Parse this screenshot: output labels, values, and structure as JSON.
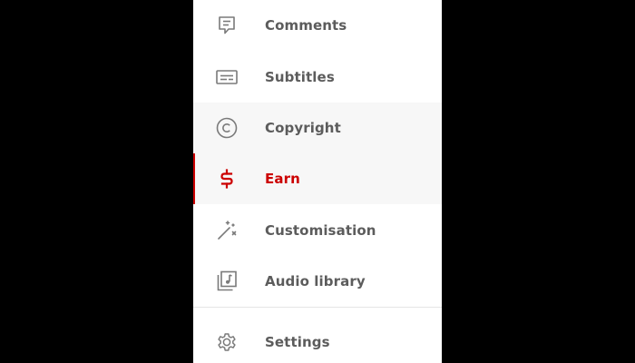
{
  "colors": {
    "accent": "#cc0000",
    "text": "#5c5c5c",
    "icon": "#7a7a7a",
    "highlight_bg": "#f7f7f7"
  },
  "menu": {
    "items": [
      {
        "label": "Comments",
        "icon": "comment-icon",
        "state": "default"
      },
      {
        "label": "Subtitles",
        "icon": "subtitles-icon",
        "state": "default"
      },
      {
        "label": "Copyright",
        "icon": "copyright-icon",
        "state": "hover"
      },
      {
        "label": "Earn",
        "icon": "dollar-icon",
        "state": "active"
      },
      {
        "label": "Customisation",
        "icon": "magic-wand-icon",
        "state": "default"
      },
      {
        "label": "Audio library",
        "icon": "audio-library-icon",
        "state": "default"
      }
    ],
    "footer_items": [
      {
        "label": "Settings",
        "icon": "gear-icon",
        "state": "default"
      }
    ]
  }
}
